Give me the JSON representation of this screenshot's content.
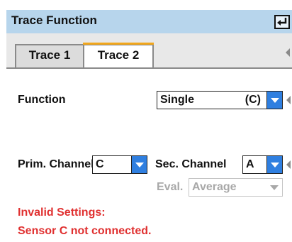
{
  "window": {
    "title": "Trace Function",
    "enter_icon": "enter-return-icon"
  },
  "tabs": [
    {
      "label": "Trace 1",
      "selected": false
    },
    {
      "label": "Trace 2",
      "selected": true
    }
  ],
  "form": {
    "function": {
      "label": "Function",
      "value": "Single",
      "suffix": "(C)"
    },
    "prim_channel": {
      "label": "Prim. Channel",
      "value": "C"
    },
    "sec_channel": {
      "label": "Sec. Channel",
      "value": "A"
    },
    "eval": {
      "label": "Eval.",
      "value": "Average",
      "enabled": false
    }
  },
  "messages": [
    "Invalid Settings:",
    "Sensor C not connected."
  ],
  "colors": {
    "titlebar": "#b7d5ec",
    "accent": "#2f7fe0",
    "tab_highlight": "#f2a71c",
    "error": "#e03030"
  }
}
